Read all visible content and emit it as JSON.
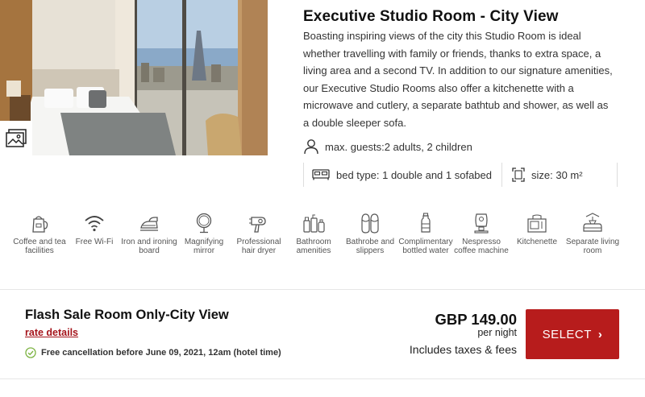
{
  "room": {
    "title": "Executive Studio Room - City View",
    "description": "Boasting inspiring views of the city this Studio Room is ideal whether travelling with family or friends, thanks to extra space, a living area and a second TV. In addition to our signature amenities, our Executive Studio Rooms also offer a kitchenette with a microwave and cutlery, a separate bathtub and shower, as well as a double sleeper sofa.",
    "guests": "max. guests:2 adults, 2 children",
    "bed_type": "bed type: 1 double and 1 sofabed",
    "size": "size: 30 m²",
    "gallery_icon": "image-gallery-icon"
  },
  "amenities": [
    {
      "icon": "kettle-icon",
      "label": "Coffee and tea facilities"
    },
    {
      "icon": "wifi-icon",
      "label": "Free Wi-Fi"
    },
    {
      "icon": "iron-icon",
      "label": "Iron and ironing board"
    },
    {
      "icon": "mirror-icon",
      "label": "Magnifying mirror"
    },
    {
      "icon": "hair-dryer-icon",
      "label": "Professional hair dryer"
    },
    {
      "icon": "bottles-icon",
      "label": "Bathroom amenities"
    },
    {
      "icon": "slippers-icon",
      "label": "Bathrobe and slippers"
    },
    {
      "icon": "water-bottle-icon",
      "label": "Complimentary bottled water"
    },
    {
      "icon": "coffee-machine-icon",
      "label": "Nespresso coffee machine"
    },
    {
      "icon": "kitchenette-icon",
      "label": "Kitchenette"
    },
    {
      "icon": "living-room-icon",
      "label": "Separate living room"
    }
  ],
  "rate": {
    "name": "Flash Sale Room Only-City View",
    "details_link": "rate details",
    "cancellation": "Free cancellation before June 09, 2021, 12am (hotel time)",
    "price": "GBP 149.00",
    "per_night": "per night",
    "taxes": "Includes taxes & fees",
    "select_label": "SELECT"
  },
  "colors": {
    "accent": "#b71c1c",
    "link": "#a5141b",
    "check": "#7cb342"
  }
}
